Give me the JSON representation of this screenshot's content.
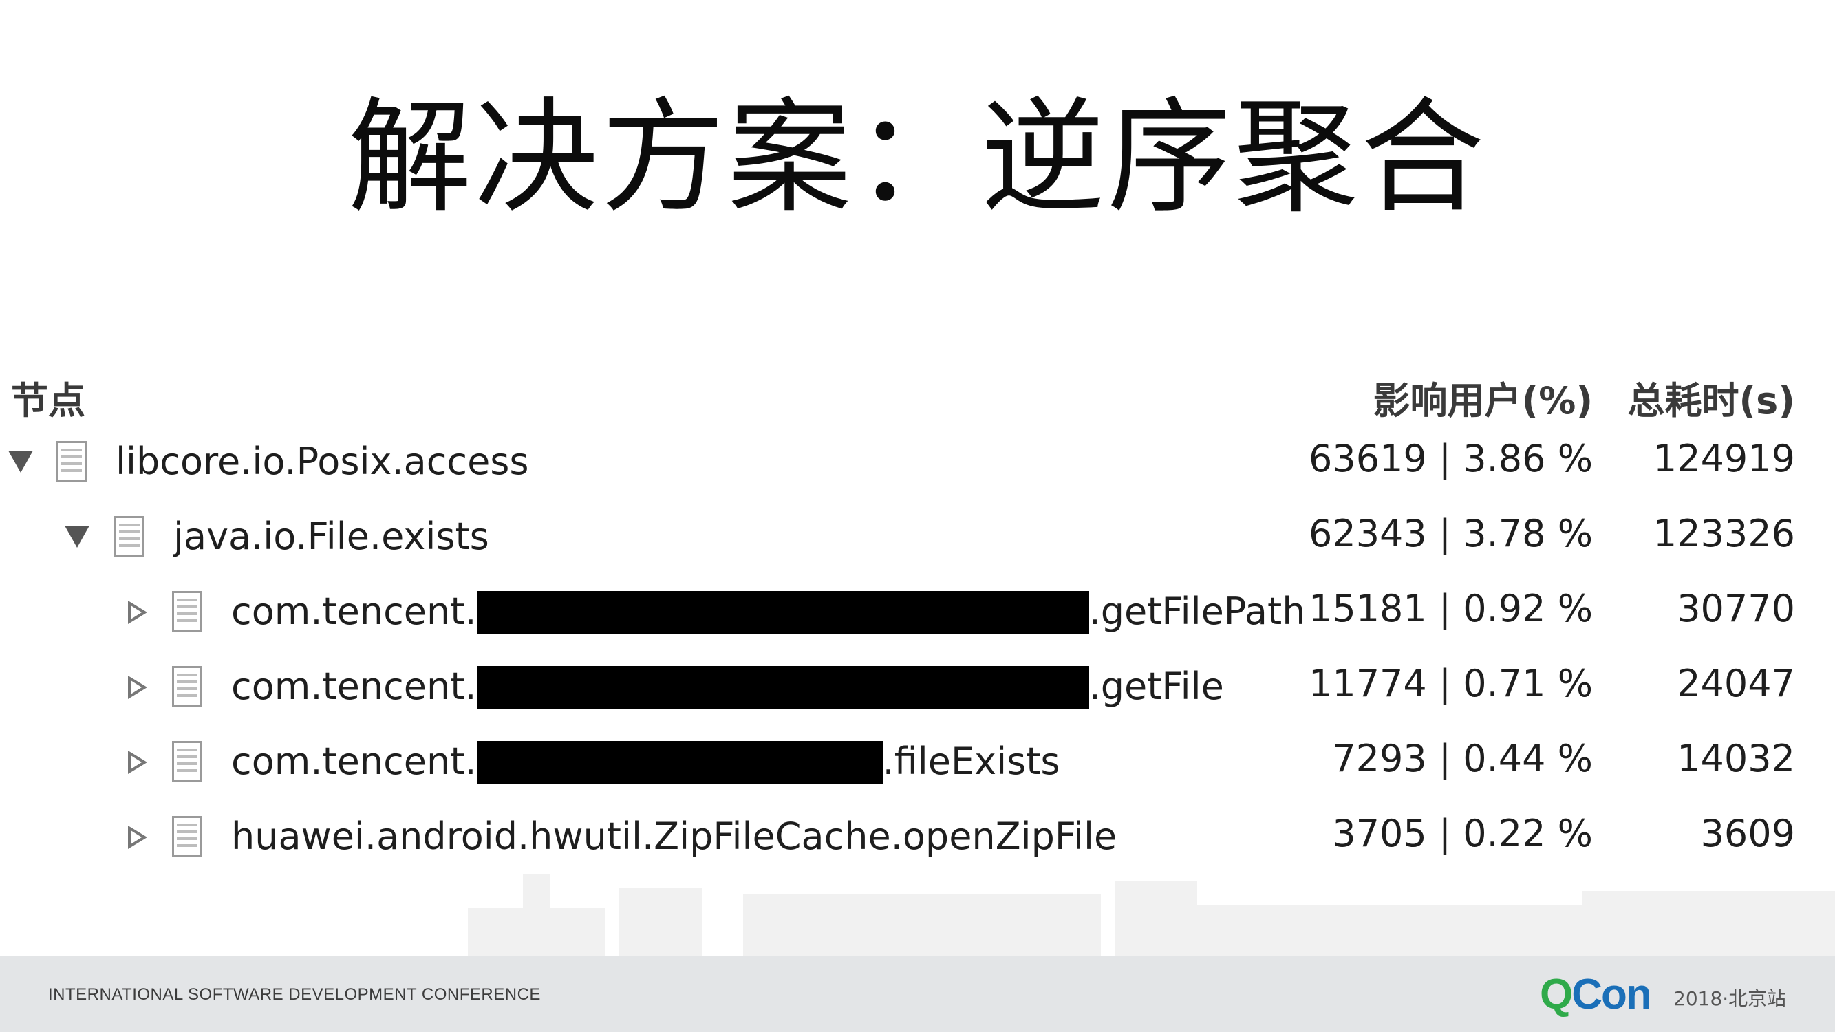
{
  "slide": {
    "title": "解决方案：逆序聚合"
  },
  "tree": {
    "columns": {
      "node": "节点",
      "users": "影响用户(%)",
      "time": "总耗时(s)"
    },
    "rows": [
      {
        "level": 0,
        "expanded": true,
        "name": "libcore.io.Posix.access",
        "prefix": "",
        "suffix": "",
        "users": "63619 | 3.86 %",
        "time": "124919"
      },
      {
        "level": 1,
        "expanded": true,
        "name": "java.io.File.exists",
        "prefix": "",
        "suffix": "",
        "users": "62343 | 3.78 %",
        "time": "123326"
      },
      {
        "level": 2,
        "expanded": false,
        "name": "",
        "prefix": "com.tencent.",
        "suffix": ".getFilePath",
        "users": "15181 | 0.92 %",
        "time": "30770"
      },
      {
        "level": 2,
        "expanded": false,
        "name": "",
        "prefix": "com.tencent.",
        "suffix": ".getFile",
        "users": "11774 | 0.71 %",
        "time": "24047"
      },
      {
        "level": 2,
        "expanded": false,
        "name": "",
        "prefix": "com.tencent.",
        "suffix": ".fileExists",
        "users": "7293 | 0.44 %",
        "time": "14032"
      },
      {
        "level": 2,
        "expanded": false,
        "name": "huawei.android.hwutil.ZipFileCache.openZipFile",
        "prefix": "",
        "suffix": "",
        "users": "3705 | 0.22 %",
        "time": "3609"
      }
    ]
  },
  "icons": {
    "expanded": "triangle-down-icon",
    "collapsed": "triangle-right-icon",
    "node": "document-icon"
  },
  "footer": {
    "conference": "INTERNATIONAL SOFTWARE DEVELOPMENT CONFERENCE",
    "logo_q": "Q",
    "logo_con": "Con",
    "edition": "2018·北京站"
  },
  "colors": {
    "logo_green": "#2faa4a",
    "logo_blue": "#1a6fb8",
    "footer_bg": "#e3e5e7",
    "redaction": "#000000"
  }
}
